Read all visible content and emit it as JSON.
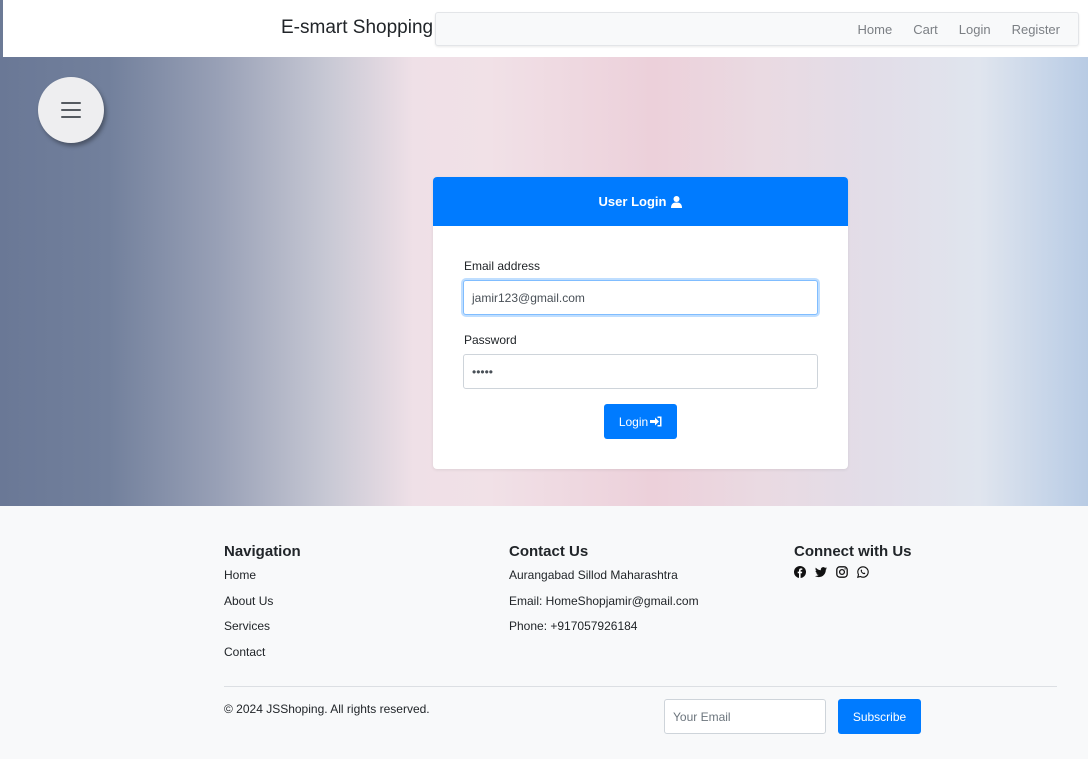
{
  "header": {
    "brand": "E-smart Shopping",
    "nav": [
      "Home",
      "Cart",
      "Login",
      "Register"
    ]
  },
  "login": {
    "title": "User Login",
    "email_label": "Email address",
    "email_value": "jamir123@gmail.com",
    "password_label": "Password",
    "password_value": "•••••",
    "button_label": "Login"
  },
  "footer": {
    "navigation": {
      "title": "Navigation",
      "items": [
        "Home",
        "About Us",
        "Services",
        "Contact"
      ]
    },
    "contact": {
      "title": "Contact Us",
      "address": "Aurangabad Sillod Maharashtra",
      "email": "Email: HomeShopjamir@gmail.com",
      "phone": "Phone: +917057926184"
    },
    "connect": {
      "title": "Connect with Us",
      "icons": [
        "facebook-icon",
        "twitter-icon",
        "instagram-icon",
        "whatsapp-icon"
      ]
    },
    "copyright": "© 2024 JSShoping. All rights reserved.",
    "email_placeholder": "Your Email",
    "subscribe_label": "Subscribe"
  },
  "colors": {
    "primary": "#007bff",
    "footer_bg": "#f8f9fa"
  }
}
